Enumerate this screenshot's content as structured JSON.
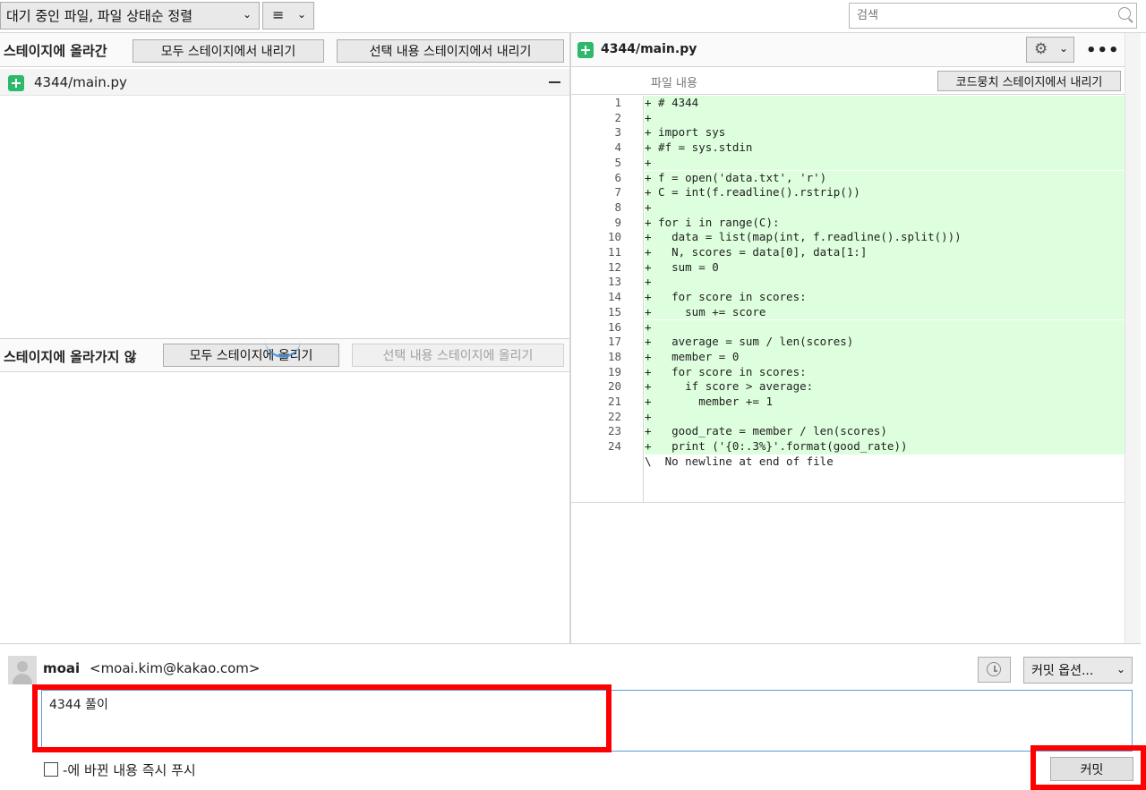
{
  "toolbar": {
    "sort_label": "대기 중인 파일, 파일 상태순 정렬",
    "list_icon": "list-icon",
    "search_placeholder": "검색"
  },
  "staged": {
    "title": "스테이지에 올라간",
    "unstage_all": "모두 스테이지에서 내리기",
    "unstage_selected": "선택 내용 스테이지에서 내리기",
    "file": "4344/main.py"
  },
  "unstaged": {
    "title": "스테이지에 올라가지 않",
    "stage_all": "모두 스테이지에 올리기",
    "stage_selected": "선택 내용 스테이지에 올리기"
  },
  "diff": {
    "file_title": "4344/main.py",
    "hunk_label": "파일 내용",
    "hunk_unstage": "코드뭉치 스테이지에서 내리기",
    "lines": [
      {
        "n": "1",
        "t": "+ # 4344"
      },
      {
        "n": "2",
        "t": "+"
      },
      {
        "n": "3",
        "t": "+ import sys"
      },
      {
        "n": "4",
        "t": "+ #f = sys.stdin"
      },
      {
        "n": "5",
        "t": "+"
      },
      {
        "n": "6",
        "t": "+ f = open('data.txt', 'r')"
      },
      {
        "n": "7",
        "t": "+ C = int(f.readline().rstrip())"
      },
      {
        "n": "8",
        "t": "+"
      },
      {
        "n": "9",
        "t": "+ for i in range(C):"
      },
      {
        "n": "10",
        "t": "+   data = list(map(int, f.readline().split()))"
      },
      {
        "n": "11",
        "t": "+   N, scores = data[0], data[1:]"
      },
      {
        "n": "12",
        "t": "+   sum = 0"
      },
      {
        "n": "13",
        "t": "+"
      },
      {
        "n": "14",
        "t": "+   for score in scores:"
      },
      {
        "n": "15",
        "t": "+     sum += score"
      },
      {
        "n": "16",
        "t": "+"
      },
      {
        "n": "17",
        "t": "+   average = sum / len(scores)"
      },
      {
        "n": "18",
        "t": "+   member = 0"
      },
      {
        "n": "19",
        "t": "+   for score in scores:"
      },
      {
        "n": "20",
        "t": "+     if score > average:"
      },
      {
        "n": "21",
        "t": "+       member += 1"
      },
      {
        "n": "22",
        "t": "+"
      },
      {
        "n": "23",
        "t": "+   good_rate = member / len(scores)"
      },
      {
        "n": "24",
        "t": "+   print ('{0:.3%}'.format(good_rate))"
      }
    ],
    "no_newline": "\\  No newline at end of file"
  },
  "commit": {
    "author_name": "moai",
    "author_email": "<moai.kim@kakao.com>",
    "options_label": "커밋 옵션...",
    "message": "4344 풀이",
    "push_label": "-에 바뀐 내용 즉시 푸시",
    "commit_label": "커밋"
  },
  "colors": {
    "added_bg": "#ddffdd",
    "accent_green": "#2eb86b",
    "highlight_red": "#ff0000"
  }
}
